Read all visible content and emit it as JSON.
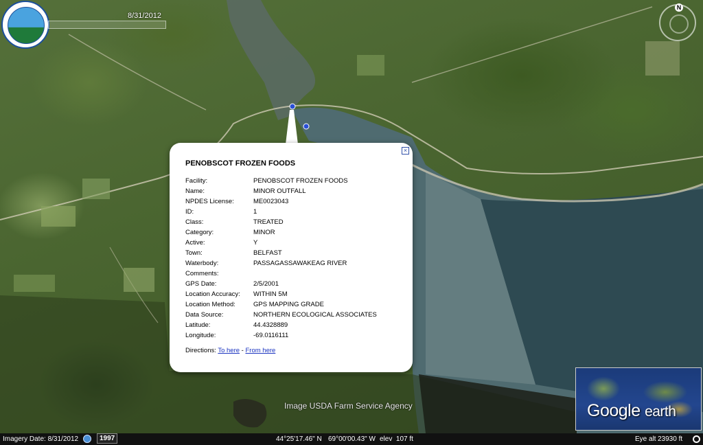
{
  "header": {
    "imagery_stamp": "8/31/2012"
  },
  "compass": {
    "north_label": "N"
  },
  "popup": {
    "title": "PENOBSCOT FROZEN FOODS",
    "close_icon": "×",
    "fields": [
      {
        "label": "Facility:",
        "value": "PENOBSCOT FROZEN FOODS"
      },
      {
        "label": "Name:",
        "value": "MINOR OUTFALL"
      },
      {
        "label": "NPDES License:",
        "value": "ME0023043"
      },
      {
        "label": "ID:",
        "value": "1"
      },
      {
        "label": "Class:",
        "value": "TREATED"
      },
      {
        "label": "Category:",
        "value": "MINOR"
      },
      {
        "label": "Active:",
        "value": "Y"
      },
      {
        "label": "Town:",
        "value": "BELFAST"
      },
      {
        "label": "Waterbody:",
        "value": "PASSAGASSAWAKEAG RIVER"
      },
      {
        "label": "Comments:",
        "value": ""
      },
      {
        "label": "GPS Date:",
        "value": "2/5/2001"
      },
      {
        "label": "Location Accuracy:",
        "value": "WITHIN 5M"
      },
      {
        "label": "Location Method:",
        "value": "GPS MAPPING GRADE"
      },
      {
        "label": "Data Source:",
        "value": "NORTHERN ECOLOGICAL ASSOCIATES"
      },
      {
        "label": "Latitude:",
        "value": "44.4328889"
      },
      {
        "label": "Longitude:",
        "value": "-69.0116111"
      }
    ],
    "directions_label": "Directions:",
    "to_here": "To here",
    "separator": "-",
    "from_here": "From here"
  },
  "imagery_source": "Image USDA Farm Service Agency",
  "logo": {
    "brand": "Google",
    "product": "earth"
  },
  "status_bar": {
    "imagery_date": "Imagery Date: 8/31/2012",
    "year": "1997",
    "latitude": "44°25'17.46\" N",
    "longitude": "69°00'00.43\" W",
    "elevation": "elev  107 ft",
    "eye_altitude_label": "Eye alt",
    "eye_altitude": "23930 ft"
  },
  "icons": {
    "compass": "compass-icon",
    "close": "close-icon",
    "timeline": "clock-icon",
    "streaming": "streaming-icon",
    "placemarks": "placemark-icon"
  },
  "colors": {
    "link": "#1a33c0",
    "water": "#2e4a52",
    "status_bar": "#111111"
  }
}
